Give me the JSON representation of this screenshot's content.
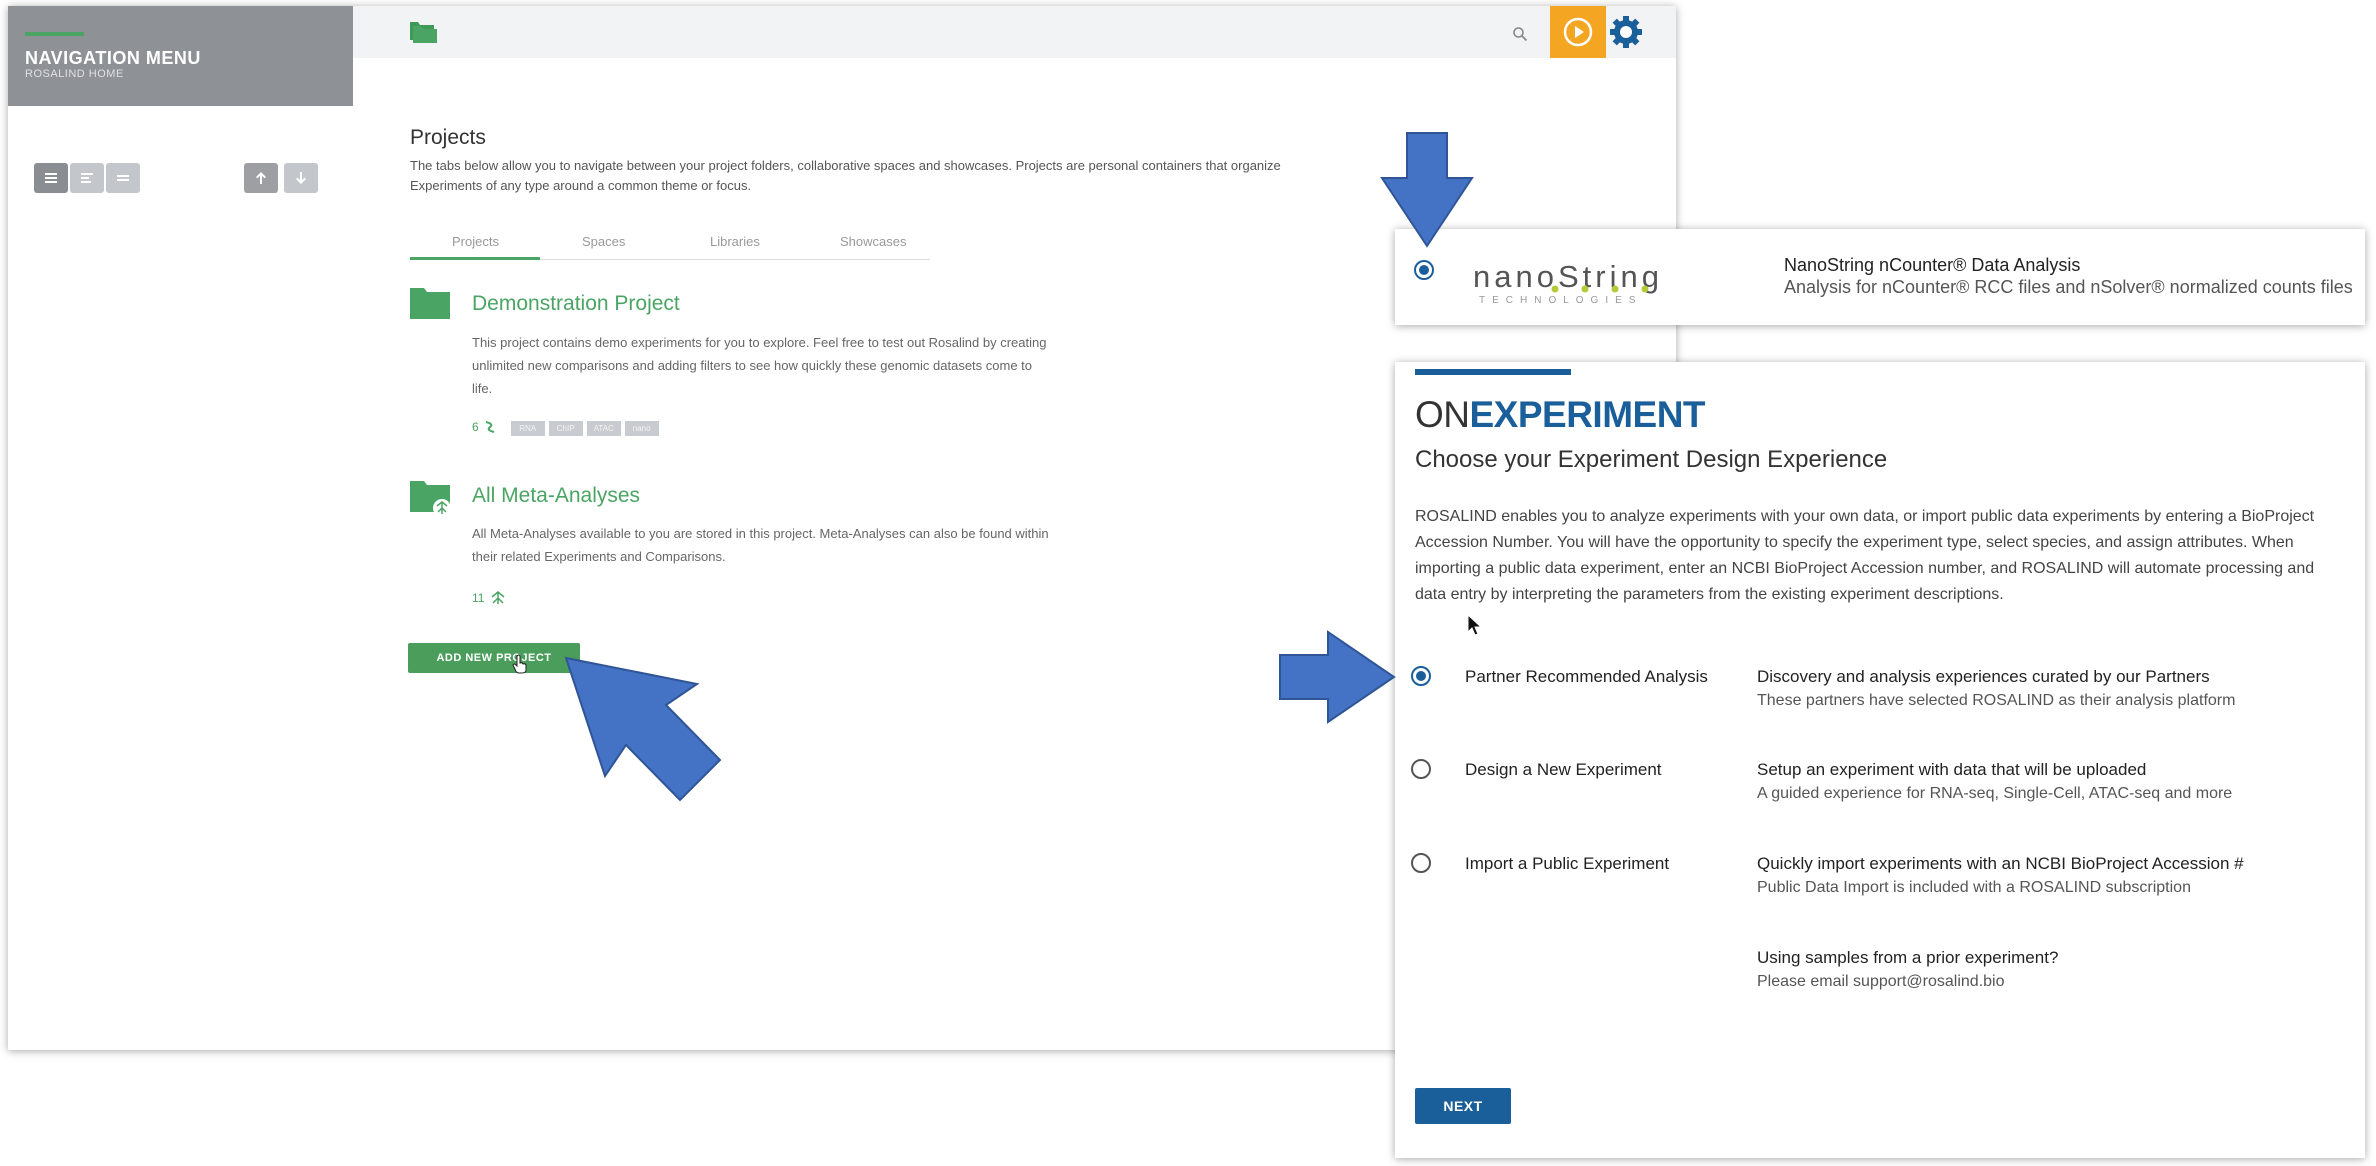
{
  "nav": {
    "title": "NAVIGATION MENU",
    "subtitle": "ROSALIND HOME"
  },
  "projects": {
    "heading": "Projects",
    "description": "The tabs below allow you to navigate between your project folders, collaborative spaces and showcases. Projects are personal containers that organize Experiments of any type around a common theme or focus.",
    "tabs": [
      "Projects",
      "Spaces",
      "Libraries",
      "Showcases"
    ],
    "active_tab": "Projects",
    "cards": [
      {
        "title": "Demonstration Project",
        "description": "This project contains demo experiments for you to explore. Feel free to test out Rosalind by creating unlimited new comparisons and adding filters to see how quickly these genomic datasets come to life.",
        "count": "6",
        "tags": [
          "RNA",
          "ChIP",
          "ATAC",
          "nano"
        ]
      },
      {
        "title": "All Meta-Analyses",
        "description": "All Meta-Analyses available to you are stored in this project. Meta-Analyses can also be found within their related Experiments and Comparisons.",
        "count": "11"
      }
    ],
    "add_button": "ADD NEW PROJECT"
  },
  "nanostring": {
    "logo_text": "nanoString",
    "logo_sub": "TECHNOLOGIES",
    "title": "NanoString nCounter® Data Analysis",
    "description": "Analysis for nCounter® RCC files and nSolver® normalized counts files"
  },
  "onexperiment": {
    "brand_prefix": "ON",
    "brand_suffix": "EXPERIMENT",
    "heading": "Choose your Experiment Design Experience",
    "intro": "ROSALIND enables you to analyze experiments with your own data, or import public data experiments by entering a BioProject Accession Number. You will have the opportunity to specify the experiment type, select species, and assign attributes. When importing a public data experiment, enter an NCBI BioProject Accession number, and ROSALIND will automate processing and data entry by interpreting the parameters from the existing experiment descriptions.",
    "options": [
      {
        "label": "Partner Recommended Analysis",
        "title": "Discovery and analysis experiences curated by our Partners",
        "desc": "These partners have selected ROSALIND as their analysis platform",
        "selected": true
      },
      {
        "label": "Design a New Experiment",
        "title": "Setup an experiment with data that will be uploaded",
        "desc": "A guided experience for RNA-seq, Single-Cell, ATAC-seq and more",
        "selected": false
      },
      {
        "label": "Import a Public Experiment",
        "title": "Quickly import experiments with an NCBI BioProject Accession #",
        "desc": "Public Data Import is included with a ROSALIND subscription",
        "selected": false
      }
    ],
    "prior": {
      "title": "Using samples from a prior experiment?",
      "desc": "Please email support@rosalind.bio"
    },
    "next_button": "NEXT"
  },
  "colors": {
    "green": "#4aa564",
    "blue": "#1b5f9a",
    "arrow": "#4472c4",
    "orange": "#f4a522"
  }
}
